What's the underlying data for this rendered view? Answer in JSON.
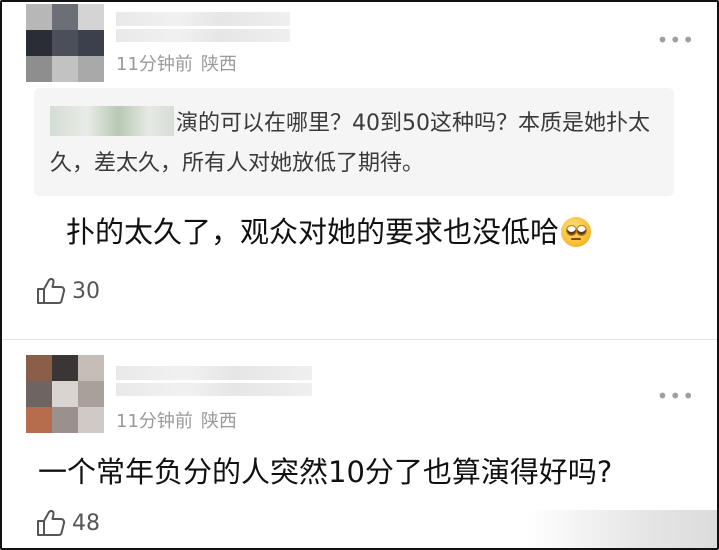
{
  "comments": [
    {
      "time": "11分钟前",
      "location": "陕西",
      "quote": "演的可以在哪里？40到50这种吗？本质是她扑太久，差太久，所有人对她放低了期待。",
      "text": "扑的太久了，观众对她的要求也没低哈",
      "emoji": "eye-roll-emoji",
      "likes": "30",
      "avatar_colors": [
        "#b7b7b7",
        "#6c6f76",
        "#d4d4d4",
        "#2a2d35",
        "#4a4f5a",
        "#3b404c",
        "#8e8e8e",
        "#c2c2c2",
        "#a9a9a9"
      ]
    },
    {
      "time": "11分钟前",
      "location": "陕西",
      "text": "一个常年负分的人突然10分了也算演得好吗?",
      "likes": "48",
      "avatar_colors": [
        "#8a5e49",
        "#3a3636",
        "#c7bdb7",
        "#6e6462",
        "#d9d4d0",
        "#a9a09b",
        "#b66d4e",
        "#9a918c",
        "#cfcac6"
      ]
    }
  ],
  "more_icon": "more-dots-icon",
  "like_icon": "thumbs-up-icon"
}
